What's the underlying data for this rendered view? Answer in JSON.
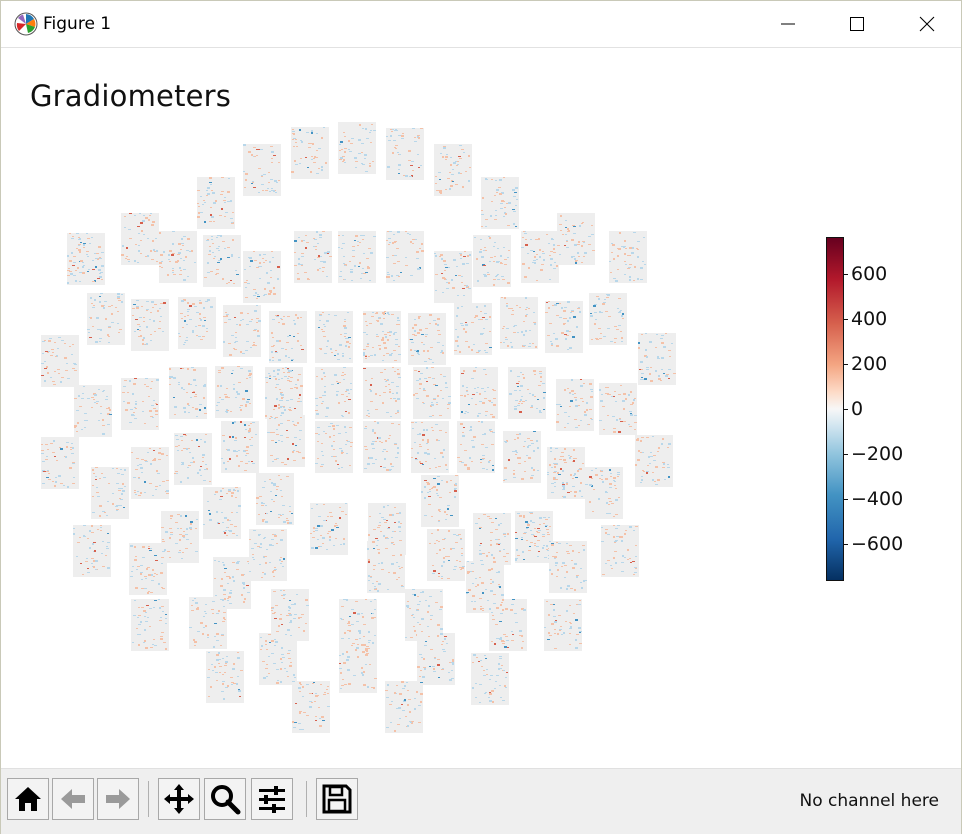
{
  "window": {
    "title": "Figure 1"
  },
  "figure": {
    "title": "Gradiometers",
    "colormap": "RdBu_r",
    "colorbar": {
      "ticks": [
        "600",
        "400",
        "200",
        "0",
        "−200",
        "−400",
        "−600"
      ],
      "tick_values": [
        600,
        400,
        200,
        0,
        -200,
        -400,
        -600
      ],
      "vmin": -760,
      "vmax": 760
    }
  },
  "toolbar": {
    "buttons": [
      "home-icon",
      "back-icon",
      "forward-icon",
      "pan-icon",
      "zoom-icon",
      "configure-subplots-icon",
      "save-icon"
    ],
    "status": "No channel here"
  },
  "colors": {
    "title_bar": "#ffffff",
    "toolbar_bg": "#efefef",
    "tile_bg": "#eeeeee",
    "colormap_top": "#67001f",
    "colormap_bottom": "#053061"
  }
}
